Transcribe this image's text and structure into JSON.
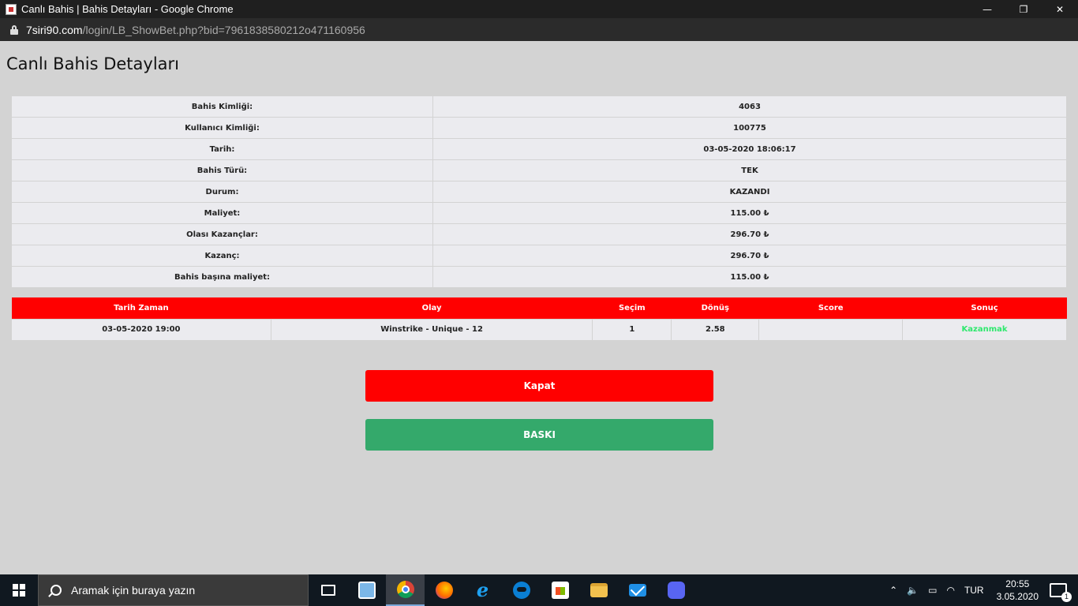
{
  "window": {
    "title": "Canlı Bahis | Bahis Detayları - Google Chrome",
    "min_glyph": "—",
    "max_glyph": "❐",
    "close_glyph": "✕"
  },
  "address": {
    "host": "7siri90.com",
    "path": "/login/LB_ShowBet.php?bid=7961838580212o471160956"
  },
  "page": {
    "title": "Canlı Bahis Detayları"
  },
  "details": [
    {
      "label": "Bahis Kimliği:",
      "value": "4063"
    },
    {
      "label": "Kullanıcı Kimliği:",
      "value": "100775"
    },
    {
      "label": "Tarih:",
      "value": "03-05-2020 18:06:17"
    },
    {
      "label": "Bahis Türü:",
      "value": "TEK"
    },
    {
      "label": "Durum:",
      "value": "KAZANDI"
    },
    {
      "label": "Maliyet:",
      "value": "115.00 ₺"
    },
    {
      "label": "Olası Kazançlar:",
      "value": "296.70 ₺"
    },
    {
      "label": "Kazanç:",
      "value": "296.70 ₺"
    },
    {
      "label": "Bahis başına maliyet:",
      "value": "115.00 ₺"
    }
  ],
  "bets": {
    "headers": [
      "Tarih Zaman",
      "Olay",
      "Seçim",
      "Dönüş",
      "Score",
      "Sonuç"
    ],
    "rows": [
      {
        "datetime": "03-05-2020 19:00",
        "event": "Winstrike - Unique - 12",
        "selection": "1",
        "return": "2.58",
        "score": "",
        "result": "Kazanmak"
      }
    ],
    "result_color": "#2ee86d"
  },
  "buttons": {
    "close_label": "Kapat",
    "print_label": "BASKI"
  },
  "taskbar": {
    "search_placeholder": "Aramak için buraya yazın",
    "language": "TUR",
    "time": "20:55",
    "date": "3.05.2020",
    "notification_count": "1"
  },
  "colors": {
    "accent_red": "#ff0000",
    "accent_green": "#34a96b"
  }
}
